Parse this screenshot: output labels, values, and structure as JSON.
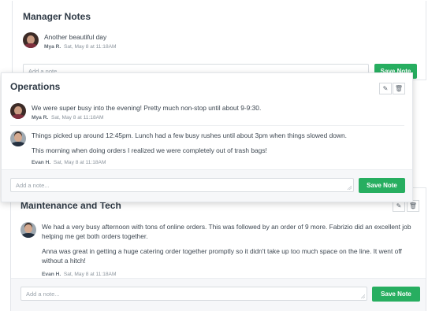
{
  "manager": {
    "title": "Manager Notes",
    "note": {
      "text": "Another beautiful day",
      "author": "Mya R.",
      "date": "Sat, May 8 at 11:18AM"
    },
    "placeholder": "Add a note...",
    "save_label": "Save Note"
  },
  "operations": {
    "title": "Operations",
    "notes": [
      {
        "text": [
          "We were super busy into the evening! Pretty much non-stop until about 9-9:30."
        ],
        "author": "Mya R.",
        "date": "Sat, May 8 at 11:18AM"
      },
      {
        "text": [
          "Things picked up around 12:45pm. Lunch had a few busy rushes until about 3pm when things slowed down.",
          "This morning when doing orders I realized we were completely out of trash bags!"
        ],
        "author": "Evan H.",
        "date": "Sat, May 8 at 11:18AM"
      }
    ],
    "placeholder": "Add a note...",
    "save_label": "Save Note",
    "edit_icon": "pencil-icon",
    "delete_icon": "trash-icon"
  },
  "maintenance": {
    "title": "Maintenance and Tech",
    "note": {
      "text": [
        "We had a very busy afternoon with tons of online orders. This was followed by an order of 9 more. Fabrizio did an excellent job helping me get both orders together.",
        "Anna was great in getting a huge catering order together promptly so it didn't take up too much space on the line. It went off without a hitch!"
      ],
      "author": "Evan H.",
      "date": "Sat, May 8 at 11:18AM"
    },
    "placeholder": "Add a note...",
    "save_label": "Save Note",
    "edit_icon": "pencil-icon",
    "delete_icon": "trash-icon"
  },
  "colors": {
    "accent": "#27ae60",
    "border": "#e3e6ea",
    "footer_bg": "#f6f7f9"
  }
}
